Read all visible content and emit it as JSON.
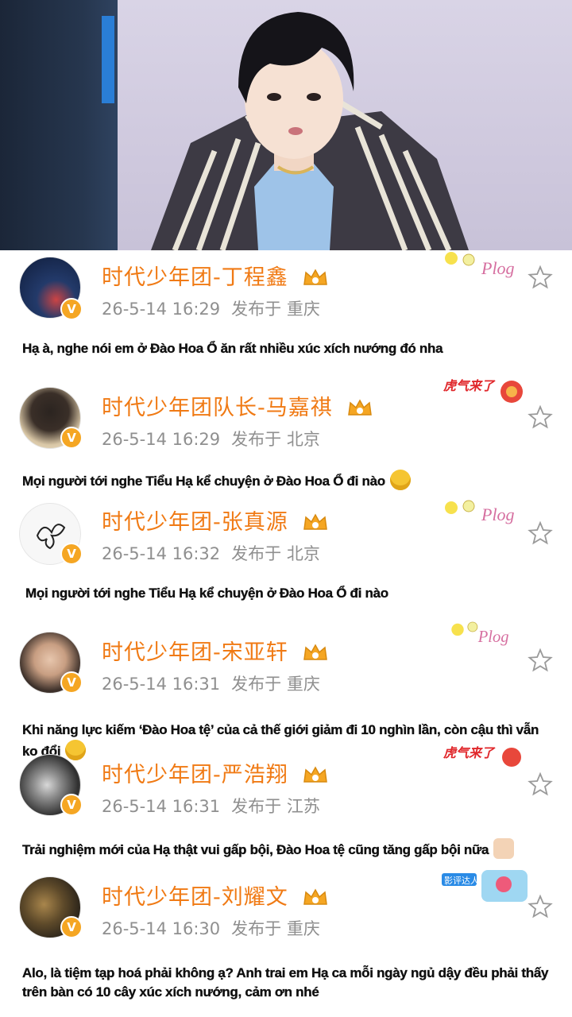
{
  "posts": [
    {
      "name": "时代少年团-丁程鑫",
      "time": "26-5-14 16:29",
      "published_prefix": "发布于",
      "location": "重庆",
      "caption": "Hạ à, nghe nói em ở Đào Hoa Ổ ăn rất nhiều xúc xích nướng đó nha",
      "emoji": "",
      "decoration": "Plog",
      "avatar_color": "#1e2e55"
    },
    {
      "name": "时代少年团队长-马嘉祺",
      "time": "26-5-14 16:29",
      "published_prefix": "发布于",
      "location": "北京",
      "caption": "Mọi người tới nghe Tiểu Hạ kể chuyện ở Đào Hoa Ổ đi nào",
      "emoji": "laughing-emoji",
      "decoration": "虎气来了",
      "avatar_color": "#d7c2a0"
    },
    {
      "name": "时代少年团-张真源",
      "time": "26-5-14 16:32",
      "published_prefix": "发布于",
      "location": "北京",
      "caption": "Mọi người tới nghe Tiểu Hạ kể chuyện ở Đào Hoa Ổ đi nào",
      "emoji": "",
      "decoration": "Plog",
      "avatar_color": "#f4f4f4"
    },
    {
      "name": "时代少年团-宋亚轩",
      "time": "26-5-14 16:31",
      "published_prefix": "发布于",
      "location": "重庆",
      "caption": "Khi năng lực kiếm ‘Đào Hoa tệ’ của cả thế giới giảm đi 10 nghìn lần, còn cậu thì vẫn ko đổi",
      "emoji": "winking-emoji",
      "decoration": "Plog",
      "avatar_color": "#8a7a6a"
    },
    {
      "name": "时代少年团-严浩翔",
      "time": "26-5-14 16:31",
      "published_prefix": "发布于",
      "location": "江苏",
      "caption": "Trải nghiệm mới của Hạ thật vui gấp bội, Đào Hoa tệ cũng tăng gấp bội nữa",
      "emoji": "thumbs-up-emoji",
      "decoration": "虎气来了",
      "avatar_color": "#5a5a5a"
    },
    {
      "name": "时代少年团-刘耀文",
      "time": "26-5-14 16:30",
      "published_prefix": "发布于",
      "location": "重庆",
      "caption": "Alo, là tiệm tạp hoá phải không ạ? Anh trai em Hạ ca mỗi ngày ngủ dậy đều phải thấy trên bàn có 10 cây xúc xích nướng, cảm ơn nhé",
      "emoji": "",
      "decoration": "影评达人",
      "avatar_color": "#4a4030"
    }
  ],
  "colors": {
    "name": "#f07a14",
    "meta": "#8f8f8f",
    "verified_badge": "#f5a623"
  }
}
